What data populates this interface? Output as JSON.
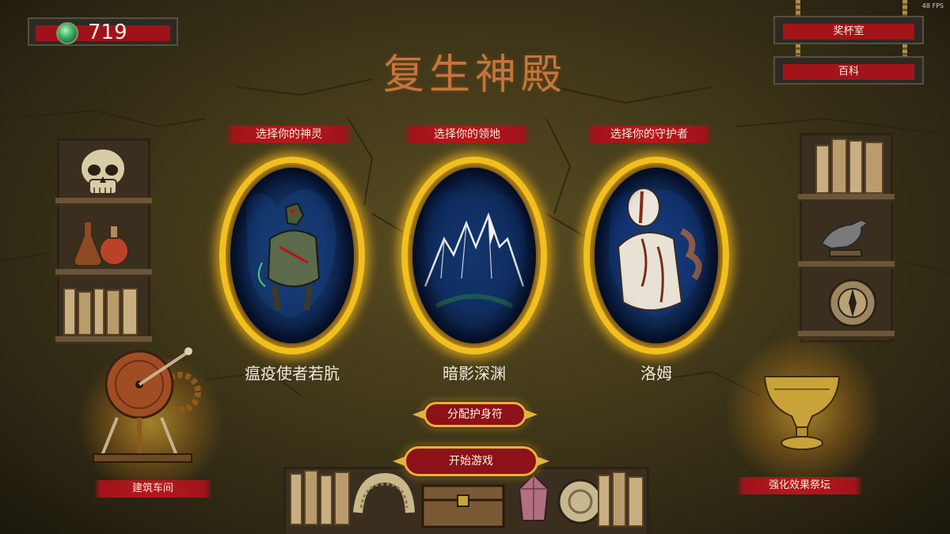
{
  "hud": {
    "currency_value": "719",
    "currency_icon": "green-gem-icon",
    "fps": "48 FPS"
  },
  "menu": {
    "trophy_room": "奖杯室",
    "encyclopedia": "百科"
  },
  "title": "复生神殿",
  "choices": [
    {
      "header": "选择你的神灵",
      "name": "瘟疫使者若肮",
      "art": "plague-god-portrait"
    },
    {
      "header": "选择你的领地",
      "name": "暗影深渊",
      "art": "shadow-abyss-mountains"
    },
    {
      "header": "选择你的守护者",
      "name": "洛姆",
      "art": "guardian-portrait"
    }
  ],
  "actions": {
    "assign_amulets": "分配护身符",
    "start_game": "开始游戏"
  },
  "stations": {
    "workshop": "建筑车间",
    "altar": "强化效果祭坛"
  },
  "colors": {
    "accent_red": "#a3141a",
    "portal_gold": "#f0c01e",
    "title_orange": "#c6753a"
  }
}
